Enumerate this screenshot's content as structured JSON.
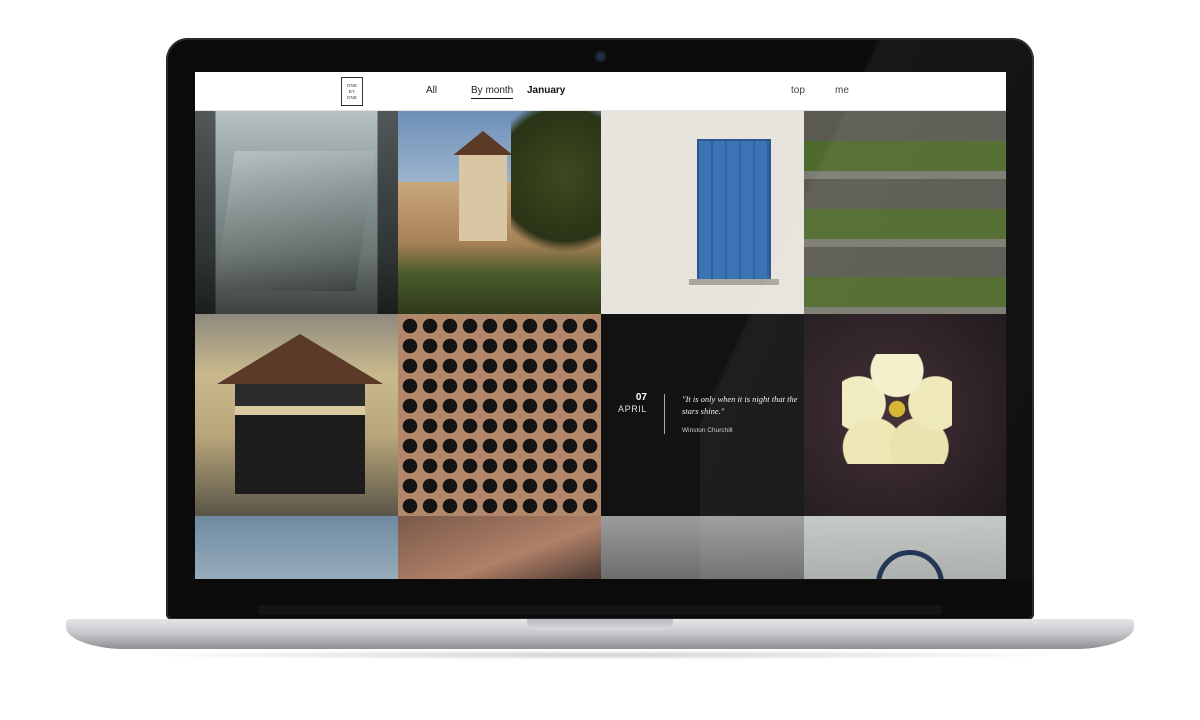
{
  "logo": {
    "lines": [
      "ONE",
      "BY",
      "ONE"
    ]
  },
  "nav": {
    "all": "All",
    "by_month": "By month",
    "month": "January",
    "top": "top",
    "me": "me"
  },
  "quote": {
    "day": "07",
    "month": "APRIL",
    "text": "\"It is only when it is night that the stars shine.\"",
    "author": "Winston Churchill"
  },
  "colors": {
    "nav_bg": "#ffffff",
    "quote_bg": "#121212",
    "text": "#222222"
  }
}
